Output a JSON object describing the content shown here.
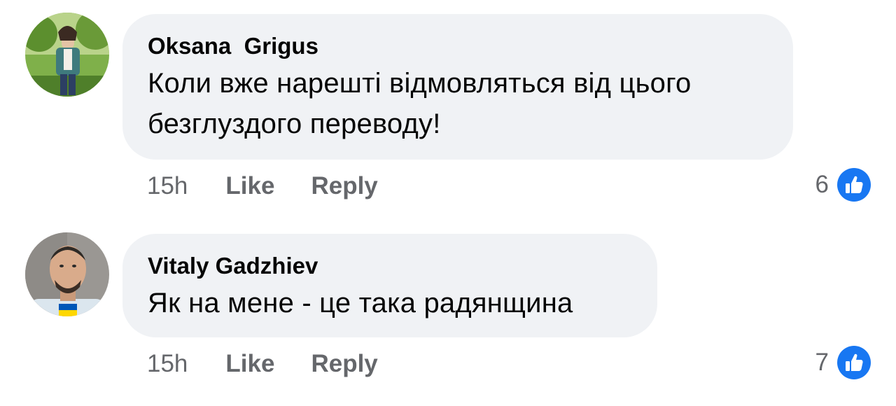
{
  "colors": {
    "bubble_bg": "#f0f2f5",
    "text": "#050505",
    "meta_text": "#65676b",
    "like_blue": "#1877f2"
  },
  "comments": [
    {
      "author": "Oksana  Grigus",
      "text_lines": [
        "Коли вже нарешті відмовляться від цього",
        "безглуздого переводу!"
      ],
      "time": "15h",
      "like_label": "Like",
      "reply_label": "Reply",
      "reaction_count": "6",
      "reaction_icon": "thumbs-up-icon"
    },
    {
      "author": "Vitaly Gadzhiev",
      "text_lines": [
        "Як на мене - це така радянщина"
      ],
      "time": "15h",
      "like_label": "Like",
      "reply_label": "Reply",
      "reaction_count": "7",
      "reaction_icon": "thumbs-up-icon"
    }
  ]
}
